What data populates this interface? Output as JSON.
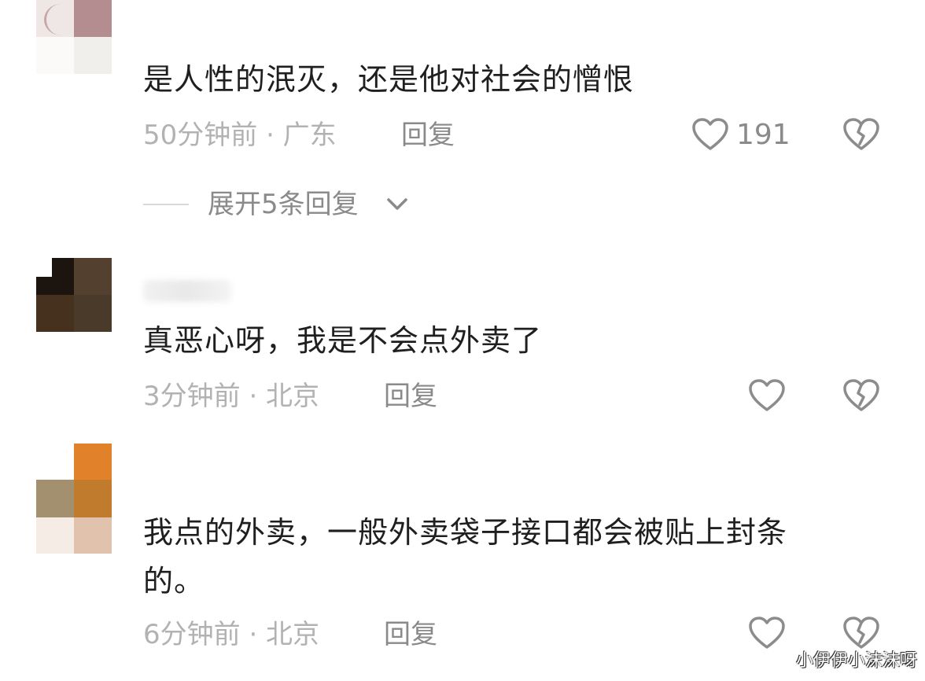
{
  "comments": [
    {
      "text": "是人性的泯灭，还是他对社会的憎恨",
      "meta": "50分钟前 · 广东",
      "reply_label": "回复",
      "like_count": "191",
      "expand_replies": "展开5条回复"
    },
    {
      "text": "真恶心呀，我是不会点外卖了",
      "meta": "3分钟前 · 北京",
      "reply_label": "回复"
    },
    {
      "text_line1": "我点的外卖，一般外卖袋子接口都会被贴上封条",
      "text_line2": "的。",
      "meta": "6分钟前 · 北京",
      "reply_label": "回复"
    }
  ],
  "watermark": "小伊伊小沫沫呀",
  "colors": {
    "text": "#1f1f1f",
    "meta": "#b2b2b2",
    "action": "#8a8a8a",
    "icon_stroke": "#8c8c8c"
  },
  "icons": {
    "like": "heart-outline-icon",
    "dislike": "broken-heart-icon",
    "expand": "chevron-down-icon"
  }
}
